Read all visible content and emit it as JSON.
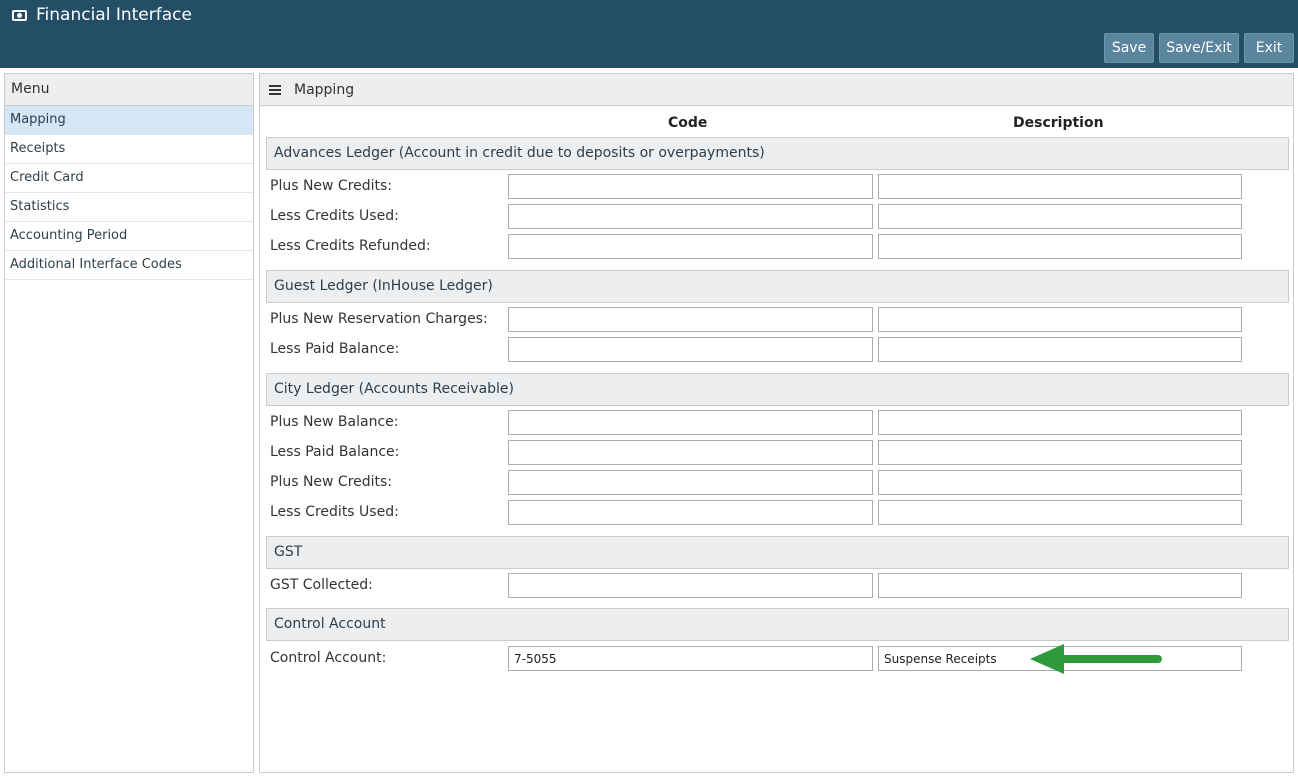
{
  "app": {
    "title": "Financial Interface"
  },
  "toolbar": {
    "save": "Save",
    "save_exit": "Save/Exit",
    "exit": "Exit"
  },
  "sidebar": {
    "title": "Menu",
    "items": [
      "Mapping",
      "Receipts",
      "Credit Card",
      "Statistics",
      "Accounting Period",
      "Additional Interface Codes"
    ],
    "active": "Mapping"
  },
  "main": {
    "title": "Mapping",
    "columns": {
      "code": "Code",
      "description": "Description"
    },
    "sections": [
      {
        "title": "Advances Ledger (Account in credit due to deposits or overpayments)",
        "rows": [
          {
            "label": "Plus New Credits:",
            "code": "",
            "description": ""
          },
          {
            "label": "Less Credits Used:",
            "code": "",
            "description": ""
          },
          {
            "label": "Less Credits Refunded:",
            "code": "",
            "description": ""
          }
        ]
      },
      {
        "title": "Guest Ledger (InHouse Ledger)",
        "rows": [
          {
            "label": "Plus New Reservation Charges:",
            "code": "",
            "description": ""
          },
          {
            "label": "Less Paid Balance:",
            "code": "",
            "description": ""
          }
        ]
      },
      {
        "title": "City Ledger (Accounts Receivable)",
        "rows": [
          {
            "label": "Plus New Balance:",
            "code": "",
            "description": ""
          },
          {
            "label": "Less Paid Balance:",
            "code": "",
            "description": ""
          },
          {
            "label": "Plus New Credits:",
            "code": "",
            "description": ""
          },
          {
            "label": "Less Credits Used:",
            "code": "",
            "description": ""
          }
        ]
      },
      {
        "title": "GST",
        "rows": [
          {
            "label": "GST Collected:",
            "code": "",
            "description": ""
          }
        ]
      },
      {
        "title": "Control Account",
        "rows": [
          {
            "label": "Control Account:",
            "code": "7-5055",
            "description": "Suspense Receipts"
          }
        ]
      }
    ]
  },
  "colors": {
    "topbar": "#244d66",
    "button": "#5b849e",
    "active_menu": "#d5e6f6",
    "arrow": "#2e9a3c"
  }
}
